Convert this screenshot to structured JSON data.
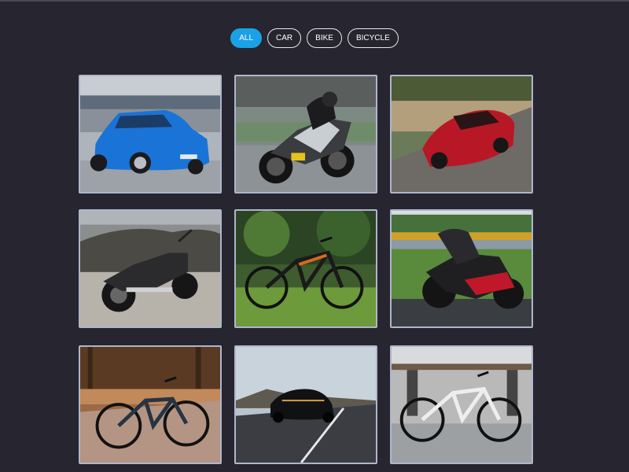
{
  "filters": [
    {
      "label": "ALL",
      "active": true
    },
    {
      "label": "CAR",
      "active": false
    },
    {
      "label": "BIKE",
      "active": false
    },
    {
      "label": "BICYCLE",
      "active": false
    }
  ],
  "gallery": [
    {
      "category": "car",
      "subject": "blue-hatchback"
    },
    {
      "category": "bike",
      "subject": "racing-motorbike"
    },
    {
      "category": "car",
      "subject": "red-sports-car"
    },
    {
      "category": "bike",
      "subject": "cruiser-motorbike"
    },
    {
      "category": "bicycle",
      "subject": "mountain-bicycle"
    },
    {
      "category": "bike",
      "subject": "red-racing-motorbike"
    },
    {
      "category": "bicycle",
      "subject": "forest-bicycle"
    },
    {
      "category": "car",
      "subject": "black-muscle-car"
    },
    {
      "category": "bicycle",
      "subject": "white-bicycle"
    }
  ],
  "colors": {
    "background": "#27252f",
    "accent": "#1aa1e6",
    "tile_border": "#aeb6cc"
  }
}
